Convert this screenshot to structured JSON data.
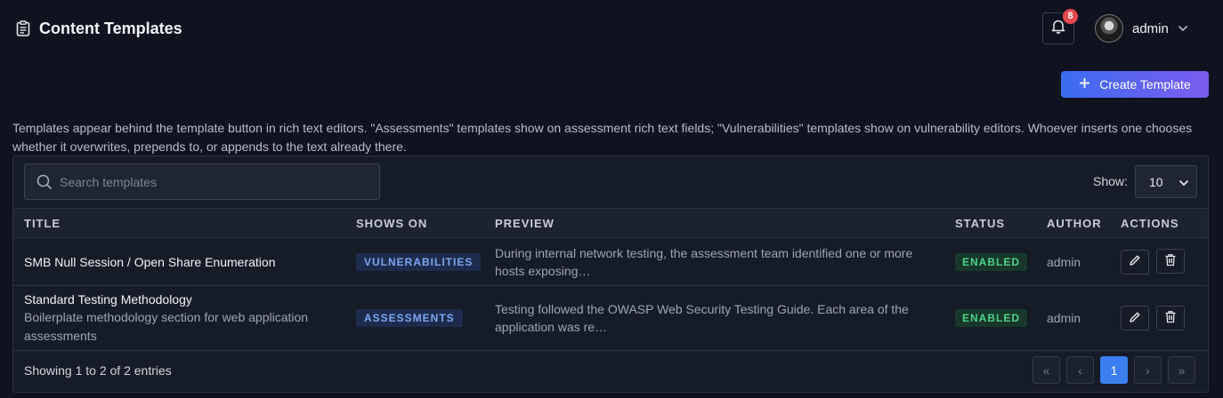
{
  "header": {
    "title": "Content Templates",
    "notifications_count": "8",
    "username": "admin"
  },
  "toolbar": {
    "create_label": "Create Template"
  },
  "description": "Templates appear behind the template button in rich text editors. \"Assessments\" templates show on assessment rich text fields; \"Vulnerabilities\" templates show on vulnerability editors. Whoever inserts one chooses whether it overwrites, prepends to, or appends to the text already there.",
  "search": {
    "placeholder": "Search templates",
    "value": ""
  },
  "page_size": {
    "label": "Show:",
    "value": "10"
  },
  "table": {
    "columns": [
      "TITLE",
      "SHOWS ON",
      "PREVIEW",
      "STATUS",
      "AUTHOR",
      "ACTIONS"
    ],
    "rows": [
      {
        "title": "SMB Null Session / Open Share Enumeration",
        "subtitle": "",
        "shows_on": "VULNERABILITIES",
        "preview": "During internal network testing, the assessment team identified one or more hosts exposing…",
        "status": "ENABLED",
        "author": "admin"
      },
      {
        "title": "Standard Testing Methodology",
        "subtitle": "Boilerplate methodology section for web application assessments",
        "shows_on": "ASSESSMENTS",
        "preview": "Testing followed the OWASP Web Security Testing Guide. Each area of the application was re…",
        "status": "ENABLED",
        "author": "admin"
      }
    ]
  },
  "footer": {
    "entries_text": "Showing 1 to 2 of 2 entries",
    "pagination": {
      "first": "«",
      "prev": "‹",
      "current": "1",
      "next": "›",
      "last": "»"
    }
  },
  "colors": {
    "background": "#0f1320",
    "accent": "#3b7ef0",
    "create_gradient_start": "#3b6cf0",
    "create_gradient_end": "#7b5cf0",
    "enabled": "#4fd18b",
    "chip_text": "#7aa7f0",
    "badge": "#e5484d"
  },
  "icons": [
    "clipboard-icon",
    "bell-icon",
    "chevron-down-icon",
    "plus-icon",
    "search-icon",
    "pencil-icon",
    "trash-icon"
  ]
}
